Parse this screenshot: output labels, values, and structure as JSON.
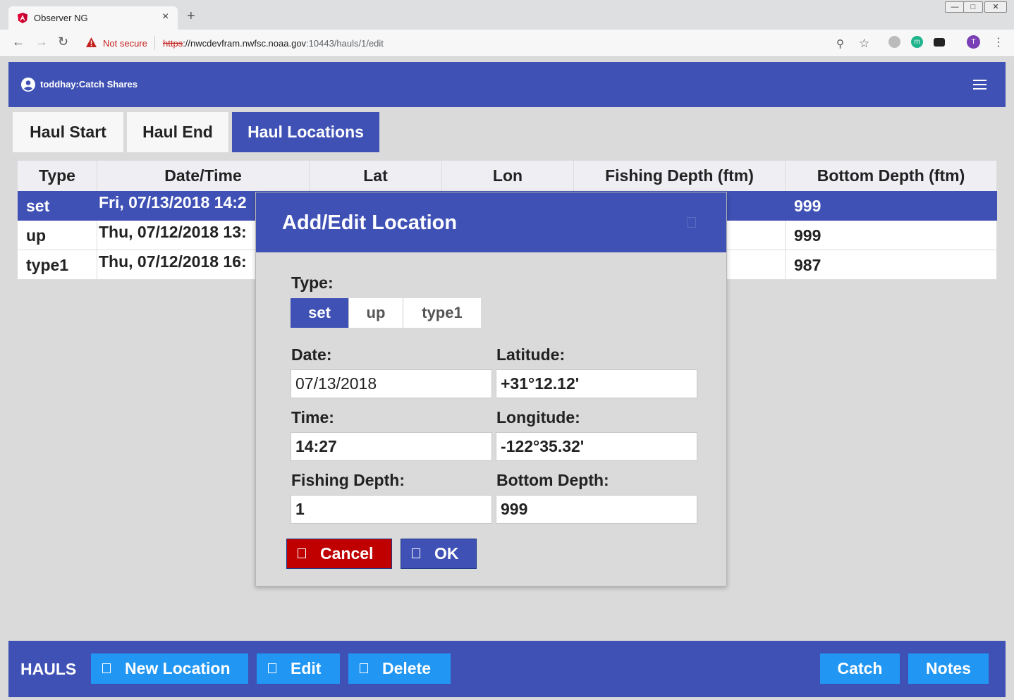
{
  "browser": {
    "tab_title": "Observer NG",
    "tab_close": "×",
    "new_tab": "+",
    "window_controls": {
      "minimize": "—",
      "maximize": "□",
      "close": "✕"
    },
    "not_secure": "Not secure",
    "url_scheme": "https",
    "url_host": "://nwcdevfram.nwfsc.noaa.gov",
    "url_path": ":10443/hauls/1/edit",
    "extension_m": "m",
    "profile_initial": "T",
    "colors": {
      "not_secure": "#c5221f",
      "ext_m": "#1fb48c",
      "profile": "#7b3fb5"
    }
  },
  "header": {
    "user": "toddhay:Catch Shares",
    "icons": [
      "account-icon",
      "hamburger-menu-icon"
    ]
  },
  "tabs": [
    {
      "label": "Haul Start",
      "active": false
    },
    {
      "label": "Haul End",
      "active": false
    },
    {
      "label": "Haul Locations",
      "active": true
    }
  ],
  "table": {
    "columns": [
      "Type",
      "Date/Time",
      "Lat",
      "Lon",
      "Fishing Depth (ftm)",
      "Bottom Depth (ftm)"
    ],
    "rows": [
      {
        "type": "set",
        "datetime": "Fri, 07/13/2018 14:2",
        "bottom": "999",
        "selected": true
      },
      {
        "type": "up",
        "datetime": "Thu, 07/12/2018 13:",
        "bottom": "999",
        "selected": false
      },
      {
        "type": "type1",
        "datetime": "Thu, 07/12/2018 16:",
        "bottom": "987",
        "selected": false
      }
    ]
  },
  "modal": {
    "title": "Add/Edit Location",
    "type_label": "Type:",
    "type_options": [
      "set",
      "up",
      "type1"
    ],
    "type_selected": "set",
    "date_label": "Date:",
    "date_value": "07/13/2018",
    "latitude_label": "Latitude:",
    "latitude_value": "+31°12.12'",
    "time_label": "Time:",
    "time_value": "14:27",
    "longitude_label": "Longitude:",
    "longitude_value": "-122°35.32'",
    "fishing_depth_label": "Fishing Depth:",
    "fishing_depth_value": "1",
    "bottom_depth_label": "Bottom Depth:",
    "bottom_depth_value": "999",
    "cancel_label": "Cancel",
    "ok_label": "OK"
  },
  "footer": {
    "title": "HAULS",
    "new_location": "New Location",
    "edit": "Edit",
    "delete": "Delete",
    "catch": "Catch",
    "notes": "Notes"
  },
  "colors": {
    "primary": "#3f51b5",
    "accent": "#2196f3",
    "danger": "#c00000",
    "background": "#dadada"
  }
}
